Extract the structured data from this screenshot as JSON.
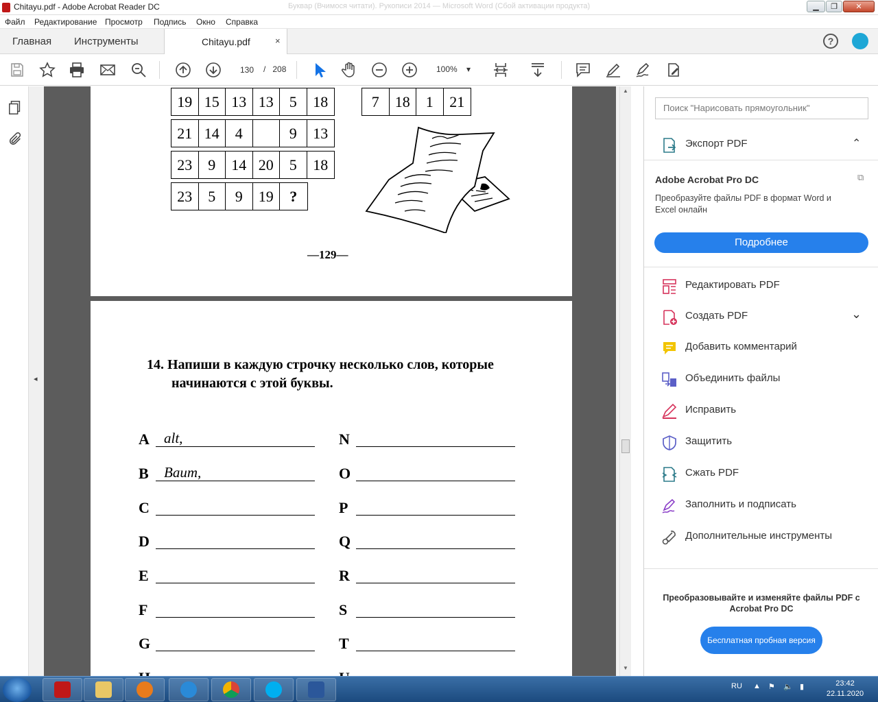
{
  "window": {
    "title": "Chitayu.pdf - Adobe Acrobat Reader DC",
    "background_title": "Буквар (Вчимося читати). Рукописи 2014 — Microsoft Word (Сбой активации продукта)"
  },
  "menu": [
    "Файл",
    "Редактирование",
    "Просмотр",
    "Подпись",
    "Окно",
    "Справка"
  ],
  "tabs": {
    "home": "Главная",
    "tools": "Инструменты",
    "document": "Chitayu.pdf",
    "close": "×"
  },
  "toolbar": {
    "page_current": "130",
    "page_sep": "/",
    "page_total": "208",
    "zoom": "100%"
  },
  "page129": {
    "grid_rows": [
      [
        "19",
        "15",
        "13",
        "13",
        "5",
        "18"
      ],
      [
        "21",
        "14",
        "4",
        "",
        "9",
        "13"
      ],
      [
        "23",
        "9",
        "14",
        "20",
        "5",
        "18"
      ],
      [
        "23",
        "5",
        "9",
        "19",
        "?"
      ]
    ],
    "grid_right": [
      "7",
      "18",
      "1",
      "21"
    ],
    "page_number": "—129—"
  },
  "page130": {
    "task": "14. Напиши в каждую строчку несколько слов, которые",
    "task_line2": "начинаются с этой буквы.",
    "left_letters": [
      "A",
      "B",
      "C",
      "D",
      "E",
      "F",
      "G",
      "H"
    ],
    "right_letters": [
      "N",
      "O",
      "P",
      "Q",
      "R",
      "S",
      "T",
      "U"
    ],
    "handwritten": {
      "a": "alt,",
      "b": "Baum,"
    }
  },
  "right_panel": {
    "search_placeholder": "Поиск \"Нарисовать прямоугольник\"",
    "export": "Экспорт PDF",
    "promo_title": "Adobe Acrobat Pro DC",
    "promo_text": "Преобразуйте файлы PDF в формат Word и Excel онлайн",
    "promo_button": "Подробнее",
    "tools": [
      "Редактировать PDF",
      "Создать PDF",
      "Добавить комментарий",
      "Объединить файлы",
      "Исправить",
      "Защитить",
      "Сжать PDF",
      "Заполнить и подписать",
      "Дополнительные инструменты"
    ],
    "bottom_promo": "Преобразовывайте и изменяйте файлы PDF с Acrobat Pro DC",
    "trial_button": "Бесплатная пробная версия"
  },
  "taskbar": {
    "lang": "RU",
    "time": "23:42",
    "date": "22.11.2020"
  },
  "colors": {
    "accent": "#2680eb",
    "acrobat_red": "#c01818",
    "viewer_bg": "#5c5c5c"
  }
}
